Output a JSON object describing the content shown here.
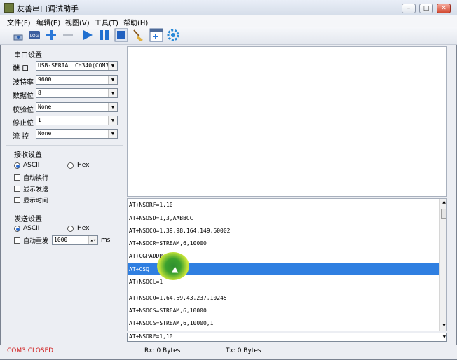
{
  "window": {
    "title": "友善串口调试助手",
    "buttons": {
      "minimize": "–",
      "maximize": "□",
      "close": "✕"
    }
  },
  "menu": [
    "文件(F)",
    "编辑(E)",
    "视图(V)",
    "工具(T)",
    "帮助(H)"
  ],
  "serial": {
    "group": "串口设置",
    "port_label": "端  口",
    "port_value": "USB-SERIAL CH340(COM3)",
    "baud_label": "波特率",
    "baud_value": "9600",
    "data_label": "数据位",
    "data_value": "8",
    "parity_label": "校验位",
    "parity_value": "None",
    "stop_label": "停止位",
    "stop_value": "1",
    "flow_label": "流  控",
    "flow_value": "None"
  },
  "receive": {
    "group": "接收设置",
    "ascii": "ASCII",
    "hex": "Hex",
    "auto_newline": "自动换行",
    "show_send": "显示发送",
    "show_time": "显示时间"
  },
  "send": {
    "group": "发送设置",
    "ascii": "ASCII",
    "hex": "Hex",
    "auto_resend": "自动重发",
    "interval": "1000",
    "unit": "ms"
  },
  "send_list": [
    "AT+NSORF=1,10",
    "AT+NSOSD=1,3,AABBCC",
    "AT+NSOCO=1,39.98.164.149,60002",
    "AT+NSOCR=STREAM,6,10000",
    "AT+CGPADDR",
    "AT+CSQ",
    "AT+NSOCL=1",
    "AT+NSOCO=1,64.69.43.237,10245",
    "AT+NSOCS=STREAM,6,10000",
    "AT+NSOCS=STREAM,6,10000,1"
  ],
  "send_combo_value": "AT+NSORF=1,10",
  "status": {
    "port": "COM3 CLOSED",
    "rx": "Rx: 0 Bytes",
    "tx": "Tx: 0 Bytes"
  },
  "colors": {
    "selected_row": "#2f7fe1",
    "status_closed": "#d02020"
  }
}
